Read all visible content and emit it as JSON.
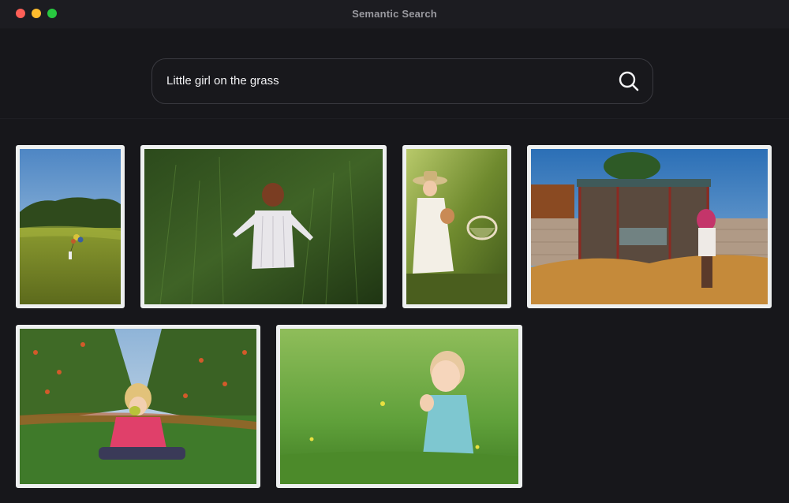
{
  "window": {
    "title": "Semantic Search",
    "controls": [
      "close",
      "minimize",
      "zoom"
    ]
  },
  "search": {
    "query": "Little girl on the grass",
    "icon": "search-icon"
  },
  "results": [
    {
      "name": "result-image-girl-balloons-hill",
      "icon": "photo"
    },
    {
      "name": "result-image-girl-tall-grass-back",
      "icon": "photo"
    },
    {
      "name": "result-image-girl-straw-hat-basket",
      "icon": "photo"
    },
    {
      "name": "result-image-girl-hut-field",
      "icon": "photo"
    },
    {
      "name": "result-image-girl-orchard-apple",
      "icon": "photo"
    },
    {
      "name": "result-image-toddler-green-meadow",
      "icon": "photo"
    }
  ],
  "colors": {
    "background": "#17171b",
    "titlebar": "#1c1c21",
    "frame": "#eef0f0",
    "search_border": "#3a3a40"
  }
}
